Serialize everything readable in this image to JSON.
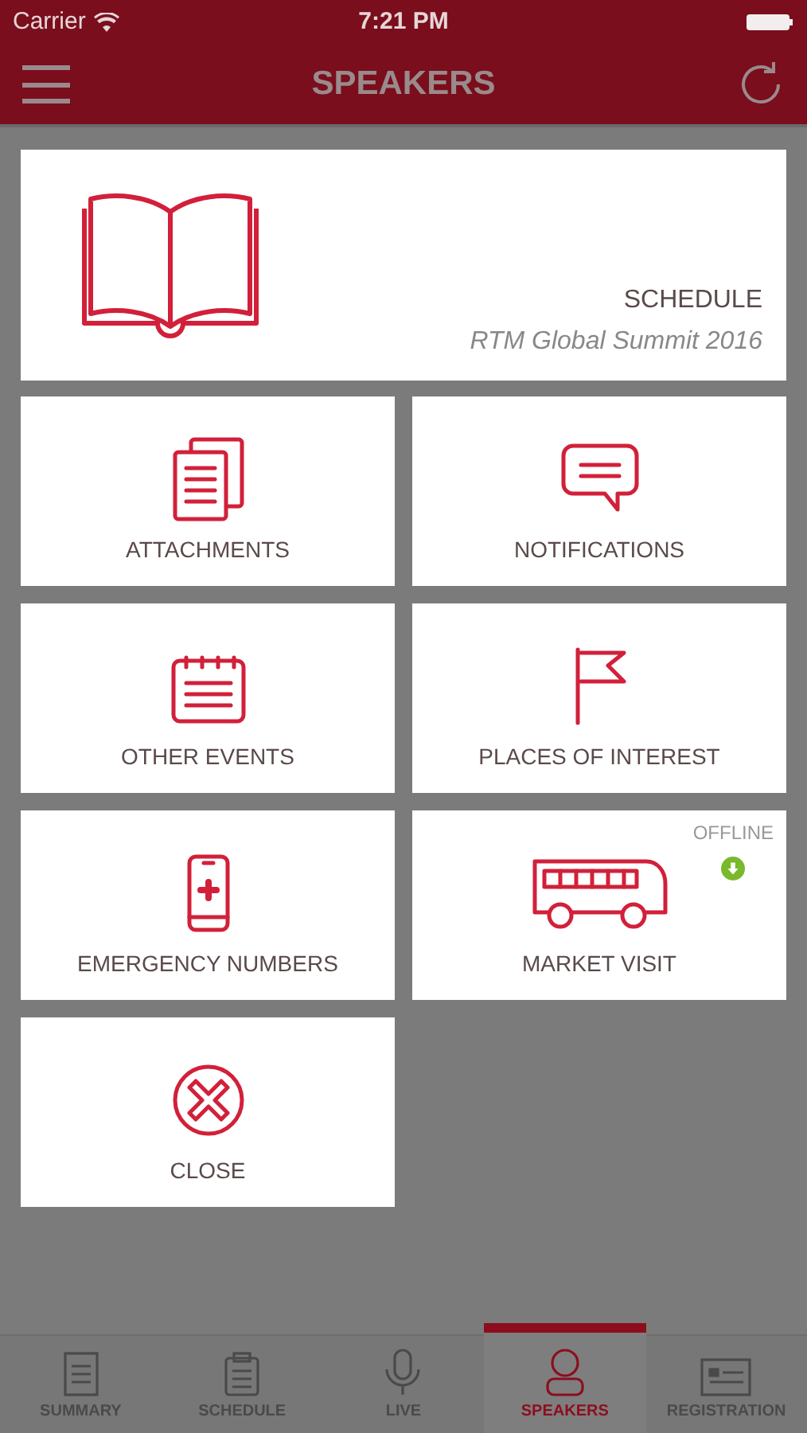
{
  "status_bar": {
    "carrier": "Carrier",
    "time": "7:21 PM"
  },
  "header": {
    "title": "SPEAKERS"
  },
  "menu": {
    "featured": {
      "label": "SCHEDULE",
      "subtitle": "RTM Global Summit 2016"
    },
    "items": [
      {
        "kind": "attachments",
        "label": "ATTACHMENTS"
      },
      {
        "kind": "notifications",
        "label": "NOTIFICATIONS"
      },
      {
        "kind": "calendar",
        "label": "OTHER EVENTS"
      },
      {
        "kind": "flag",
        "label": "PLACES OF INTEREST"
      },
      {
        "kind": "phone",
        "label": "EMERGENCY NUMBERS"
      },
      {
        "kind": "bus",
        "label": "MARKET VISIT",
        "badge": "OFFLINE"
      },
      {
        "kind": "close",
        "label": "CLOSE"
      }
    ]
  },
  "tabs": [
    {
      "kind": "summary",
      "label": "SUMMARY",
      "selected": false
    },
    {
      "kind": "schedule",
      "label": "SCHEDULE",
      "selected": false
    },
    {
      "kind": "live",
      "label": "LIVE",
      "selected": false
    },
    {
      "kind": "speakers",
      "label": "SPEAKERS",
      "selected": true
    },
    {
      "kind": "registration",
      "label": "REGISTRATION",
      "selected": false
    }
  ]
}
